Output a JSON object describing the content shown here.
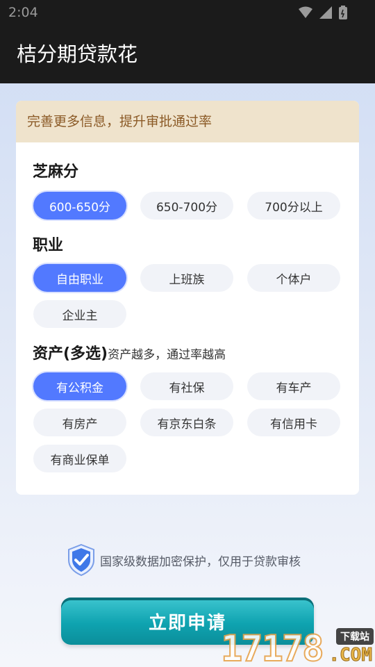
{
  "status_bar": {
    "time": "2:04"
  },
  "app_bar": {
    "title": "桔分期贷款花"
  },
  "form": {
    "banner": "完善更多信息，提升审批通过率",
    "sesame": {
      "title": "芝麻分",
      "options": [
        "600-650分",
        "650-700分",
        "700分以上"
      ],
      "selected": "600-650分"
    },
    "job": {
      "title": "职业",
      "options": [
        "自由职业",
        "上班族",
        "个体户",
        "企业主"
      ],
      "selected": "自由职业"
    },
    "assets": {
      "title": "资产(多选)",
      "subtitle": "资产越多，通过率越高",
      "options": [
        "有公积金",
        "有社保",
        "有车产",
        "有房产",
        "有京东白条",
        "有信用卡",
        "有商业保单"
      ],
      "selected": [
        "有公积金"
      ]
    }
  },
  "security_note": "国家级数据加密保护，仅用于贷款审核",
  "apply_button": "立即申请",
  "watermark": {
    "digits": "17178",
    "badge": "下载站",
    "suffix": ".COM"
  },
  "colors": {
    "accent": "#5279ff",
    "button": "#0fa3b0",
    "banner_bg": "#efe3cc",
    "banner_text": "#8b5a26"
  }
}
